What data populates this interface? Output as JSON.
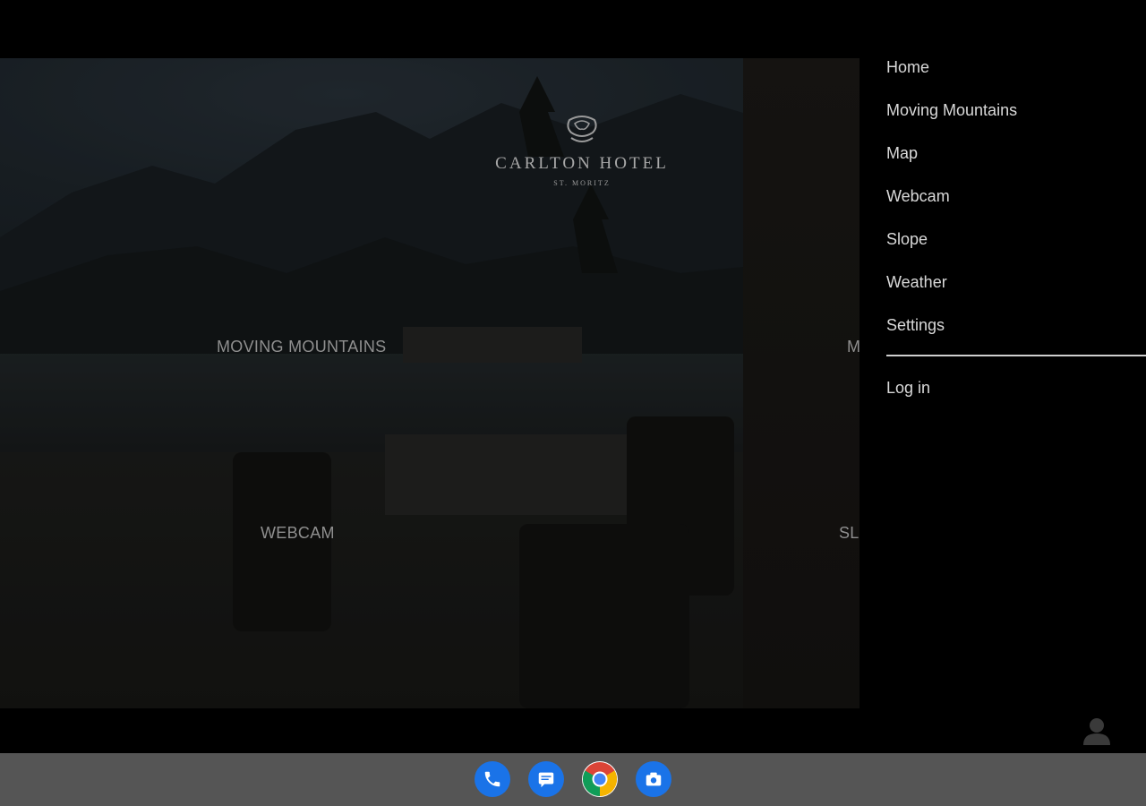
{
  "app": {
    "brand_name": "CARLTON HOTEL",
    "brand_location": "ST. MORITZ"
  },
  "tiles": [
    {
      "label": "MOVING MOUNTAINS"
    },
    {
      "label": "M"
    },
    {
      "label": "WEBCAM"
    },
    {
      "label": "SL"
    }
  ],
  "drawer": {
    "items": [
      {
        "label": "Home"
      },
      {
        "label": "Moving Mountains"
      },
      {
        "label": "Map"
      },
      {
        "label": "Webcam"
      },
      {
        "label": "Slope"
      },
      {
        "label": "Weather"
      },
      {
        "label": "Settings"
      }
    ],
    "login_label": "Log in"
  },
  "dock": {
    "apps": [
      "phone-icon",
      "messages-icon",
      "chrome-icon",
      "camera-icon"
    ]
  },
  "colors": {
    "drawer_bg": "#000000",
    "drawer_text": "#d9d9d9",
    "dock_bg": "#555555",
    "accent_blue": "#1a73e8"
  }
}
